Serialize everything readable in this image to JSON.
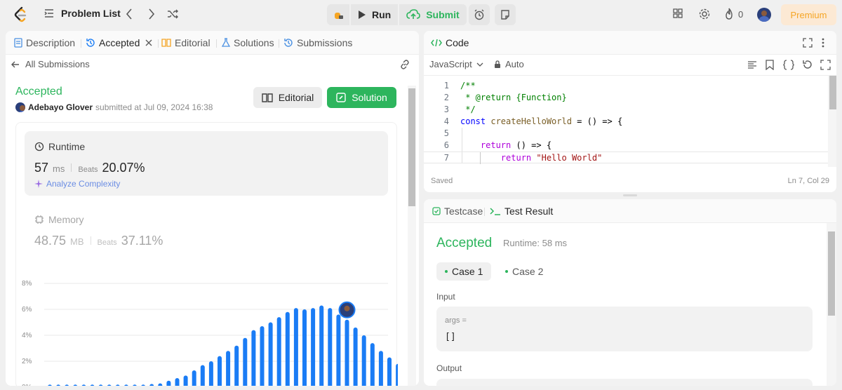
{
  "topbar": {
    "problem_list": "Problem List",
    "run": "Run",
    "submit": "Submit",
    "streak_count": "0",
    "premium": "Premium"
  },
  "left_tabs": {
    "description": "Description",
    "accepted": "Accepted",
    "editorial": "Editorial",
    "solutions": "Solutions",
    "submissions": "Submissions"
  },
  "submission": {
    "back": "All Submissions",
    "status": "Accepted",
    "user": "Adebayo Glover",
    "submitted_at": "submitted at Jul 09, 2024 16:38",
    "editorial_btn": "Editorial",
    "solution_btn": "Solution"
  },
  "runtime": {
    "label": "Runtime",
    "value": "57",
    "unit": "ms",
    "beats_label": "Beats",
    "beats": "20.07%",
    "analyze": "Analyze Complexity"
  },
  "memory": {
    "label": "Memory",
    "value": "48.75",
    "unit": "MB",
    "beats_label": "Beats",
    "beats": "37.11%"
  },
  "chart_data": {
    "type": "bar",
    "y_tick_labels": [
      "8%",
      "6%",
      "4%",
      "2%",
      "0%"
    ],
    "ylim": [
      0,
      8
    ],
    "values": [
      0.2,
      0.2,
      0.2,
      0.2,
      0.2,
      0.2,
      0.2,
      0.2,
      0.2,
      0.2,
      0.2,
      0.2,
      0.25,
      0.3,
      0.5,
      0.7,
      0.9,
      1.3,
      1.7,
      2.0,
      2.4,
      2.8,
      3.2,
      3.8,
      4.4,
      4.7,
      5.0,
      5.4,
      5.8,
      6.1,
      6.0,
      6.1,
      6.3,
      6.1,
      5.6,
      5.2,
      4.6,
      4.0,
      3.4,
      2.8,
      2.3,
      1.8
    ],
    "highlight_index": 35,
    "bar_color": "#1a7cf5"
  },
  "code": {
    "title": "Code",
    "language": "JavaScript",
    "mode": "Auto",
    "saved": "Saved",
    "cursor": "Ln 7, Col 29",
    "lines": [
      {
        "n": "1",
        "parts": [
          {
            "t": "/**",
            "c": "c-comment"
          }
        ]
      },
      {
        "n": "2",
        "parts": [
          {
            "t": " * @return {Function}",
            "c": "c-comment"
          }
        ]
      },
      {
        "n": "3",
        "parts": [
          {
            "t": " */",
            "c": "c-comment"
          }
        ]
      },
      {
        "n": "4",
        "parts": [
          {
            "t": "const ",
            "c": "c-kw"
          },
          {
            "t": "createHelloWorld",
            "c": "c-fn"
          },
          {
            "t": " = () => {",
            "c": "c-plain"
          }
        ]
      },
      {
        "n": "5",
        "parts": [
          {
            "t": "",
            "c": "c-plain"
          }
        ]
      },
      {
        "n": "6",
        "parts": [
          {
            "t": "    return ",
            "c": "c-ret"
          },
          {
            "t": "() => {",
            "c": "c-plain"
          }
        ]
      },
      {
        "n": "7",
        "parts": [
          {
            "t": "        return ",
            "c": "c-ret"
          },
          {
            "t": "\"Hello World\"",
            "c": "c-str"
          }
        ]
      }
    ]
  },
  "result": {
    "testcase_tab": "Testcase",
    "result_tab": "Test Result",
    "status": "Accepted",
    "runtime": "Runtime: 58 ms",
    "case1": "Case 1",
    "case2": "Case 2",
    "input_label": "Input",
    "arg_name": "args =",
    "arg_value": "[]",
    "output_label": "Output"
  },
  "colors": {
    "accent_green": "#2db55d",
    "bar_blue": "#1a7cf5",
    "premium_orange": "#f5a524"
  }
}
